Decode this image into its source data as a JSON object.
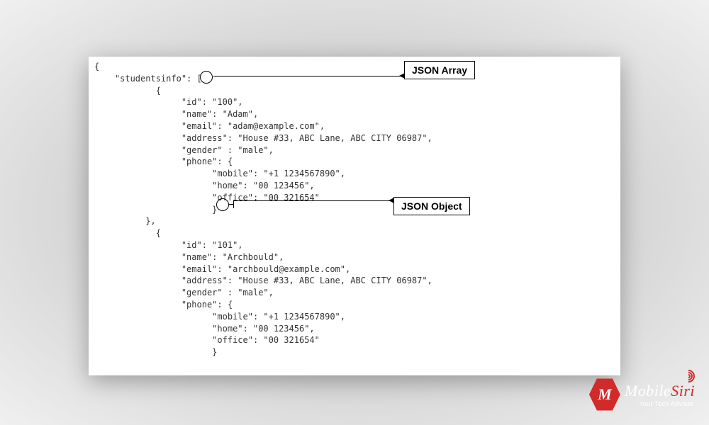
{
  "labels": {
    "json_array": "JSON Array",
    "json_object": "JSON Object"
  },
  "code": {
    "root_key": "studentsinfo",
    "students": [
      {
        "id": "100",
        "name": "Adam",
        "email": "adam@example.com",
        "address": "House #33, ABC Lane, ABC CITY 06987",
        "gender": "male",
        "phone": {
          "mobile": "+1 1234567890",
          "home": "00 123456",
          "office": "00 321654"
        }
      },
      {
        "id": "101",
        "name": "Archbould",
        "email": "archbould@example.com",
        "address": "House #33, ABC Lane, ABC CITY 06987",
        "gender": "male",
        "phone": {
          "mobile": "+1 1234567890",
          "home": "00 123456",
          "office": "00 321654"
        }
      }
    ]
  },
  "logo": {
    "letter": "M",
    "name_part1": "Mobile",
    "name_part2": "Siri",
    "tagline": "Your Tech Adviser"
  }
}
